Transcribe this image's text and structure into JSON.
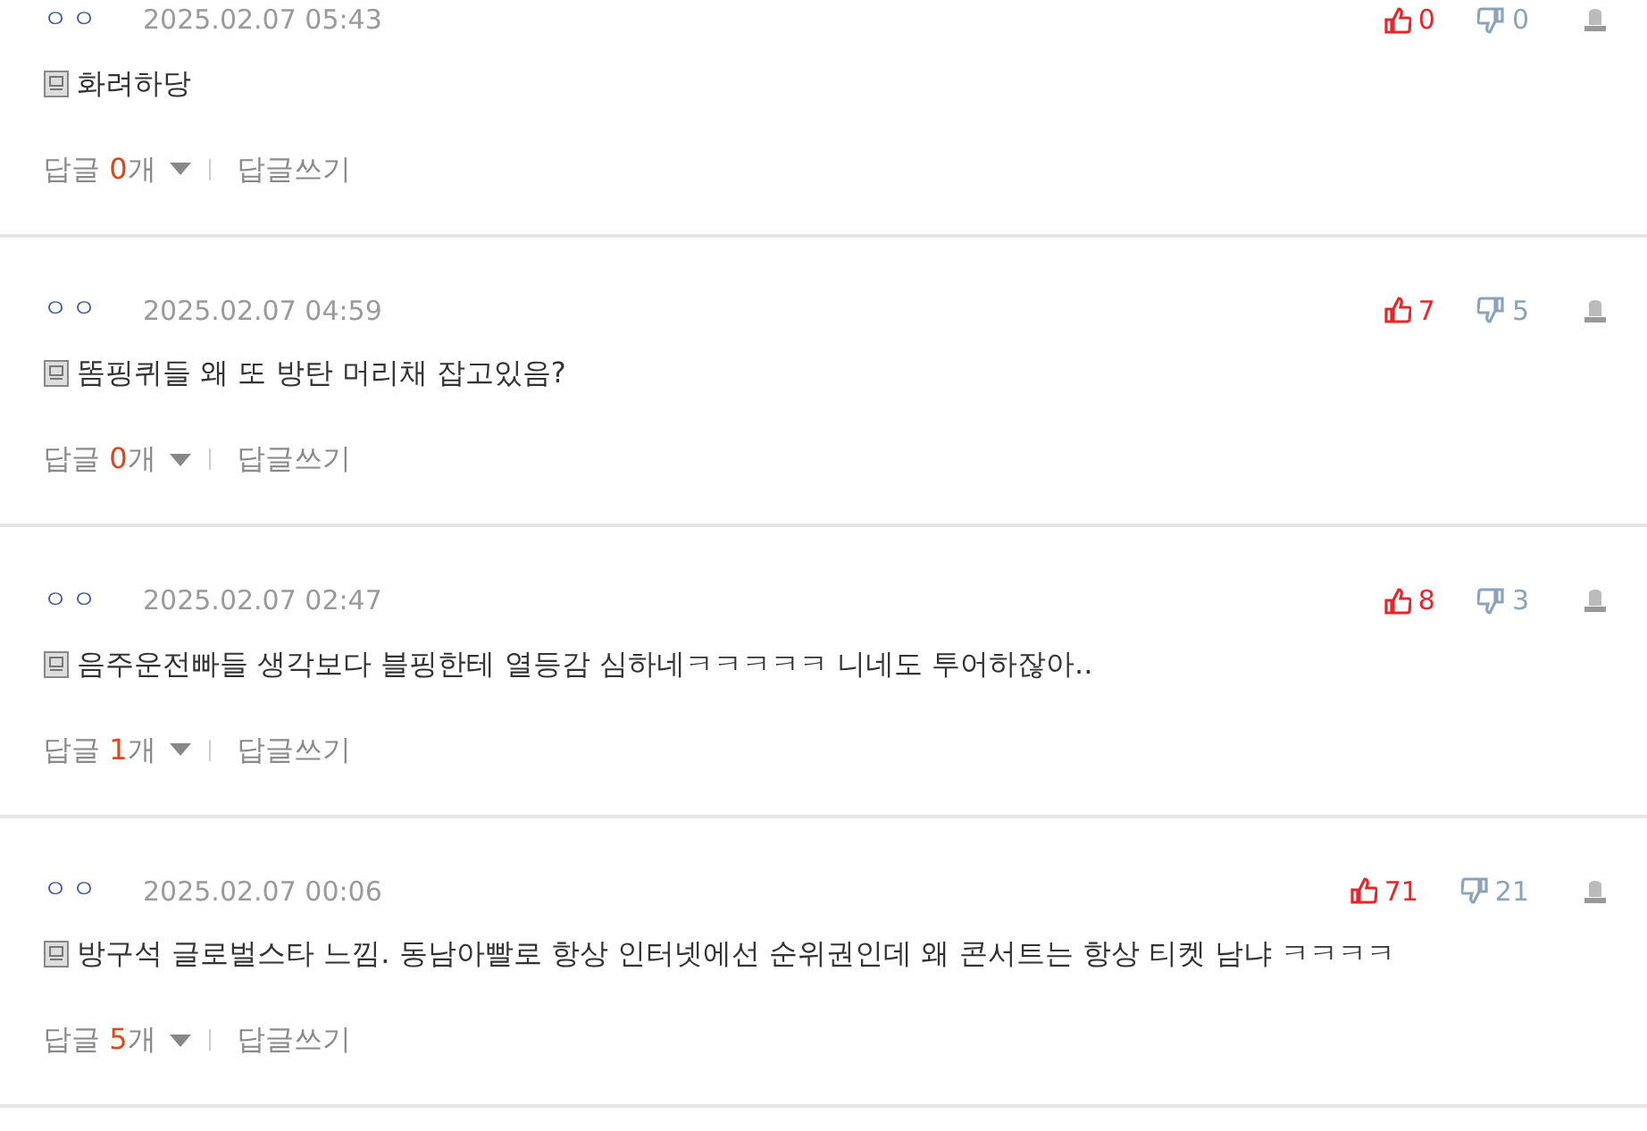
{
  "comments": [
    {
      "author": "ㅇㅇ",
      "date": "2025.02.07 05:43",
      "text": "화려하당",
      "likes": "0",
      "dislikes": "0",
      "reply_label": "답글",
      "reply_count": "0",
      "reply_unit": "개",
      "write_reply": "답글쓰기"
    },
    {
      "author": "ㅇㅇ",
      "date": "2025.02.07 04:59",
      "text": "똠핑퀴들 왜 또 방탄 머리채 잡고있음?",
      "likes": "7",
      "dislikes": "5",
      "reply_label": "답글",
      "reply_count": "0",
      "reply_unit": "개",
      "write_reply": "답글쓰기"
    },
    {
      "author": "ㅇㅇ",
      "date": "2025.02.07 02:47",
      "text": "음주운전빠들 생각보다 블핑한테 열등감 심하네ㅋㅋㅋㅋㅋ 니네도 투어하잖아..",
      "likes": "8",
      "dislikes": "3",
      "reply_label": "답글",
      "reply_count": "1",
      "reply_unit": "개",
      "write_reply": "답글쓰기"
    },
    {
      "author": "ㅇㅇ",
      "date": "2025.02.07 00:06",
      "text": "방구석 글로벌스타 느낌. 동남아빨로 항상 인터넷에선 순위권인데 왜 콘서트는 항상 티켓 남냐 ㅋㅋㅋㅋ",
      "likes": "71",
      "dislikes": "21",
      "reply_label": "답글",
      "reply_count": "5",
      "reply_unit": "개",
      "write_reply": "답글쓰기"
    }
  ]
}
